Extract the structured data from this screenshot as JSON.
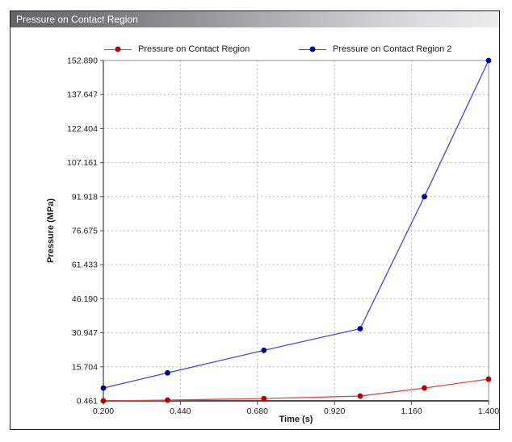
{
  "window": {
    "title": "Pressure on Contact Region"
  },
  "chart_data": {
    "type": "line",
    "title": "Pressure on Contact Region",
    "xlabel": "Time (s)",
    "ylabel": "Pressure (MPa)",
    "xlim": [
      0.2,
      1.4
    ],
    "ylim": [
      0.461,
      152.89
    ],
    "x_ticks": [
      0.2,
      0.44,
      0.68,
      0.92,
      1.16,
      1.4
    ],
    "x_tick_labels": [
      "0.200",
      "0.440",
      "0.680",
      "0.920",
      "1.160",
      "1.400"
    ],
    "y_ticks": [
      0.461,
      15.704,
      30.947,
      46.19,
      61.433,
      76.675,
      91.918,
      107.161,
      122.404,
      137.647,
      152.89
    ],
    "y_tick_labels": [
      "0.461",
      "15.704",
      "30.947",
      "46.190",
      "61.433",
      "76.675",
      "91.918",
      "107.161",
      "122.404",
      "137.647",
      "152.890"
    ],
    "grid": true,
    "grid_style": "dashed",
    "legend_position": "top",
    "series": [
      {
        "name": "Pressure on Contact Region",
        "line_color": "#e04848",
        "marker_color": "#b80000",
        "marker": "circle",
        "x": [
          0.2,
          0.4,
          0.7,
          1.0,
          1.2,
          1.4
        ],
        "y": [
          0.461,
          0.8,
          1.5,
          2.6,
          6.2,
          10.2
        ]
      },
      {
        "name": "Pressure on Contact Region 2",
        "line_color": "#4646d8",
        "marker_color": "#000099",
        "marker": "circle",
        "x": [
          0.2,
          0.4,
          0.7,
          1.0,
          1.2,
          1.4
        ],
        "y": [
          6.2,
          13.0,
          23.1,
          32.8,
          91.918,
          152.89
        ]
      }
    ]
  }
}
